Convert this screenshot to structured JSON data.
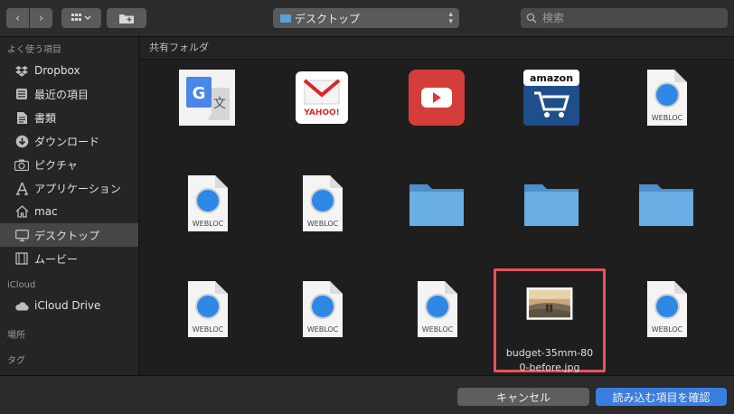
{
  "toolbar": {
    "back_icon": "chevron-left-icon",
    "forward_icon": "chevron-right-icon",
    "view_icon": "grid-view-icon",
    "new_folder_icon": "new-folder-icon",
    "location": "デスクトップ",
    "search_placeholder": "検索"
  },
  "sidebar": {
    "sections": [
      {
        "title": "よく使う項目",
        "items": [
          {
            "label": "Dropbox",
            "icon": "dropbox-icon"
          },
          {
            "label": "最近の項目",
            "icon": "recents-icon"
          },
          {
            "label": "書類",
            "icon": "documents-icon"
          },
          {
            "label": "ダウンロード",
            "icon": "downloads-icon"
          },
          {
            "label": "ピクチャ",
            "icon": "camera-icon"
          },
          {
            "label": "アプリケーション",
            "icon": "applications-icon"
          },
          {
            "label": "mac",
            "icon": "home-icon"
          },
          {
            "label": "デスクトップ",
            "icon": "desktop-icon",
            "selected": true
          },
          {
            "label": "ムービー",
            "icon": "movies-icon"
          }
        ]
      },
      {
        "title": "iCloud",
        "items": [
          {
            "label": "iCloud Drive",
            "icon": "cloud-icon"
          }
        ]
      },
      {
        "title": "場所",
        "items": []
      },
      {
        "title": "タグ",
        "items": []
      }
    ]
  },
  "content": {
    "header": "共有フォルダ",
    "items": [
      {
        "type": "google-translate",
        "caption": ""
      },
      {
        "type": "yahoo-mail",
        "caption": "",
        "logo_text": "YAHOO!"
      },
      {
        "type": "youtube",
        "caption": ""
      },
      {
        "type": "amazon",
        "caption": "",
        "logo_text": "amazon"
      },
      {
        "type": "webloc",
        "caption": "",
        "label": "WEBLOC"
      },
      {
        "type": "webloc",
        "caption": "",
        "label": "WEBLOC"
      },
      {
        "type": "webloc",
        "caption": "",
        "label": "WEBLOC"
      },
      {
        "type": "folder",
        "caption": ""
      },
      {
        "type": "folder",
        "caption": ""
      },
      {
        "type": "folder",
        "caption": ""
      },
      {
        "type": "webloc",
        "caption": "",
        "label": "WEBLOC"
      },
      {
        "type": "webloc",
        "caption": "",
        "label": "WEBLOC"
      },
      {
        "type": "webloc",
        "caption": "",
        "label": "WEBLOC"
      },
      {
        "type": "image",
        "caption": "budget-35mm-800-before.jpg",
        "caption_lines": [
          "budget-35mm-80",
          "0-before.jpg"
        ],
        "selected": true
      },
      {
        "type": "webloc",
        "caption": "",
        "label": "WEBLOC"
      }
    ]
  },
  "buttons": {
    "cancel": "キャンセル",
    "confirm": "読み込む項目を確認"
  },
  "colors": {
    "accent": "#3b7ee0",
    "selection_border": "#e9545a",
    "folder": "#5aa0da"
  }
}
